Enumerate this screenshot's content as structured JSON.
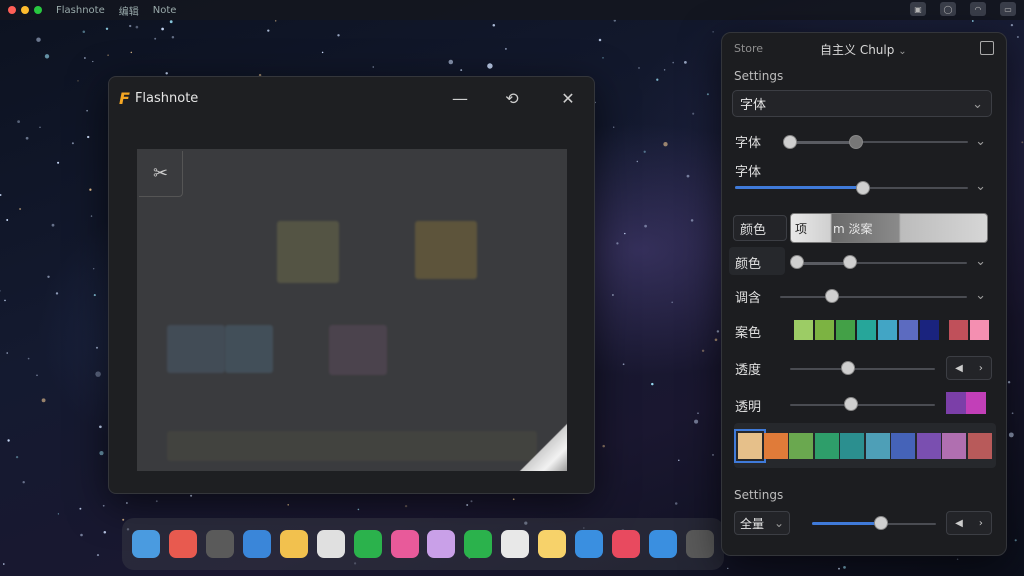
{
  "menubar": {
    "items": [
      "Flashnote",
      "编辑",
      "Note"
    ],
    "traffic_colors": [
      "#ff5f57",
      "#febc2e",
      "#28c840"
    ],
    "right_icons": [
      "screen-icon",
      "circle-icon",
      "wifi-icon",
      "battery-icon"
    ]
  },
  "window": {
    "logo": "F",
    "title": "Flashnote",
    "controls": {
      "minimize": "—",
      "rotate": "⟲",
      "close": "✕"
    },
    "tool_icon": "✂"
  },
  "dock": {
    "apps": [
      "#4a9be0",
      "#e85a4f",
      "#5a5a5a",
      "#3a86d9",
      "#f2c14e",
      "#e0e0e0",
      "#2bb24c",
      "#e85a9a",
      "#c9a0e8",
      "#2bb24c",
      "#e8e8e8",
      "#f7d26a",
      "#3a8fe0",
      "#e84a5f",
      "#3a8fe0",
      "#5a5a5a"
    ]
  },
  "panel": {
    "header_left": "Store",
    "header_mid": "自主义 Chulp",
    "settings_title": "Settings",
    "select_value": "字体",
    "row1_label": "字体",
    "row2_label": "字体",
    "color_label": "颜色",
    "grad_text_left": "项",
    "grad_text_mid": "m 淡案",
    "row3_label": "颜色",
    "row4_label": "调含",
    "row5_label": "案色",
    "row6_label": "透度",
    "row7_label": "透明",
    "settings_title_2": "Settings",
    "bottom_select": "全量",
    "swatches_small": [
      "#9ccc65",
      "#7cb342",
      "#43a047",
      "#26a69a",
      "#42a5c5",
      "#5c6bc0",
      "#1a237e",
      "#c0505a",
      "#f48fb1"
    ],
    "pair_colors": [
      "#7b3fa8",
      "#c23fb8"
    ],
    "swatches_big": [
      "#e6c08a",
      "#e07b39",
      "#6aa84f",
      "#2e9e6a",
      "#2b8f8f",
      "#4e9fb7",
      "#4563b8",
      "#7a4fb0",
      "#b06fb0",
      "#b85a5a"
    ],
    "levels": {
      "row1_range": [
        0.0,
        0.37
      ],
      "row2": 0.55,
      "row3_range": [
        0.0,
        0.31
      ],
      "row4": 0.28,
      "row6": 0.4,
      "row7": 0.42,
      "bottom": 0.56
    }
  }
}
